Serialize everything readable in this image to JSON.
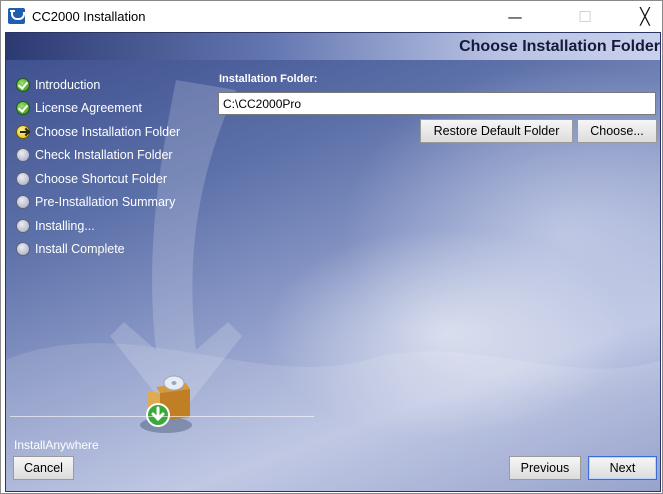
{
  "window": {
    "title": "CC2000 Installation",
    "controls": {
      "minimize": "—",
      "maximize": "☐",
      "close": "╳"
    }
  },
  "header": {
    "title": "Choose Installation Folder"
  },
  "steps": [
    {
      "label": "Introduction",
      "status": "done"
    },
    {
      "label": "License Agreement",
      "status": "done"
    },
    {
      "label": "Choose Installation Folder",
      "status": "current"
    },
    {
      "label": "Check Installation Folder",
      "status": "pending"
    },
    {
      "label": "Choose Shortcut Folder",
      "status": "pending"
    },
    {
      "label": "Pre-Installation Summary",
      "status": "pending"
    },
    {
      "label": "Installing...",
      "status": "pending"
    },
    {
      "label": "Install Complete",
      "status": "pending"
    }
  ],
  "main": {
    "folder_label": "Installation Folder:",
    "folder_value": "C:\\CC2000Pro",
    "restore_label": "Restore Default Folder",
    "choose_label": "Choose..."
  },
  "footer": {
    "brand": "InstallAnywhere",
    "cancel_label": "Cancel",
    "previous_label": "Previous",
    "next_label": "Next"
  },
  "icons": {
    "step_done": "checkmark-circle-icon",
    "step_current": "arrow-right-circle-icon",
    "step_pending": "empty-circle-icon",
    "box": "install-box-icon"
  },
  "colors": {
    "accent": "#3b6dd6",
    "panel_dark": "#3b4d8c",
    "panel_light": "#b8c1e0"
  }
}
